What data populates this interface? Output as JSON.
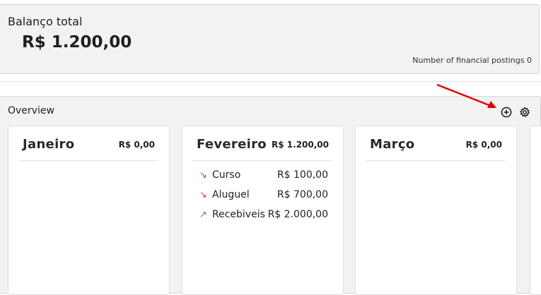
{
  "balance": {
    "title": "Balanço total",
    "amount": "R$ 1.200,00",
    "postings": "Number of financial postings 0"
  },
  "overview": {
    "title": "Overview",
    "add_icon": "plus-circle-icon",
    "settings_icon": "gear-icon"
  },
  "months": [
    {
      "name": "Janeiro",
      "total": "R$ 0,00",
      "entries": []
    },
    {
      "name": "Fevereiro",
      "total": "R$ 1.200,00",
      "entries": [
        {
          "label": "Curso",
          "value": "R$ 100,00",
          "direction": "down",
          "arrow": "↘"
        },
        {
          "label": "Aluguel",
          "value": "R$ 700,00",
          "direction": "down",
          "arrow": "↘"
        },
        {
          "label": "Recebiveis",
          "value": "R$ 2.000,00",
          "direction": "up",
          "arrow": "↗"
        }
      ]
    },
    {
      "name": "Março",
      "total": "R$ 0,00",
      "entries": []
    }
  ],
  "colors": {
    "expense": "#e53935",
    "income": "#43a047",
    "annotation": "#e00000"
  }
}
